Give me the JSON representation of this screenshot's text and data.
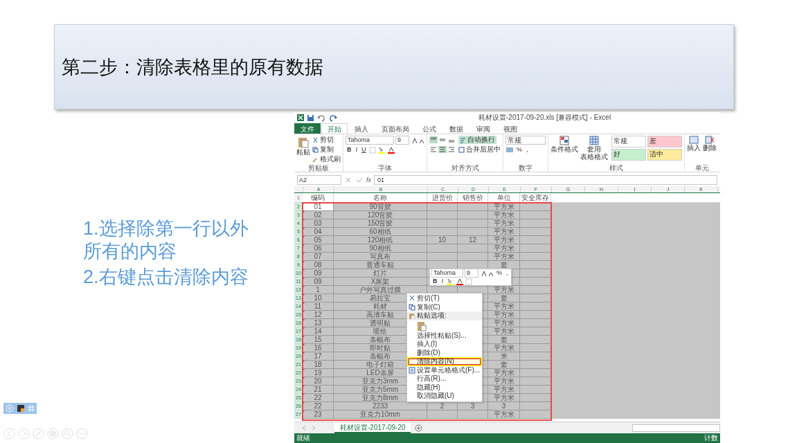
{
  "slide": {
    "title": "第二步：清除表格里的原有数据",
    "steps": [
      "1.选择除第一行以外所有的内容",
      "2.右键点击清除内容"
    ]
  },
  "excel": {
    "title": "耗材设置-2017-09-20.xls  [兼容模式] - Excel",
    "tabs": [
      {
        "label": "文件",
        "kind": "file",
        "selected": false
      },
      {
        "label": "开始",
        "kind": "tab",
        "selected": true
      },
      {
        "label": "插入",
        "kind": "tab",
        "selected": false
      },
      {
        "label": "页面布局",
        "kind": "tab",
        "selected": false
      },
      {
        "label": "公式",
        "kind": "tab",
        "selected": false
      },
      {
        "label": "数据",
        "kind": "tab",
        "selected": false
      },
      {
        "label": "审阅",
        "kind": "tab",
        "selected": false
      },
      {
        "label": "视图",
        "kind": "tab",
        "selected": false
      }
    ],
    "ribbon": {
      "clipboard": {
        "paste": "粘贴",
        "cut": "剪切",
        "copy": "复制",
        "painter": "格式刷",
        "label": "剪贴板"
      },
      "font": {
        "name": "Tahoma",
        "size": "9",
        "bold": "B",
        "italic": "I",
        "underline": "U",
        "label": "字体"
      },
      "alignment": {
        "wrap": "自动换行",
        "merge": "合并后居中",
        "label": "对齐方式"
      },
      "number": {
        "format": "常规",
        "percent": "%",
        "comma": ",",
        "label": "数字"
      },
      "styles": {
        "conditional": "条件格式",
        "table": "套用",
        "table_2": "表格格式",
        "label": "样式",
        "gallery": [
          {
            "label": "常规",
            "color": "#ffffff"
          },
          {
            "label": "差",
            "color": "#ffc7ce"
          },
          {
            "label": "好",
            "color": "#c6efce"
          },
          {
            "label": "适中",
            "color": "#ffeb9c"
          }
        ]
      },
      "cells": {
        "insert": "插入",
        "delete": "删除",
        "label": "单元"
      }
    },
    "name_box": "A2",
    "function_label": "fx",
    "formula": "01",
    "columns": [
      "A",
      "B",
      "C",
      "D",
      "E",
      "F",
      "G",
      "H",
      "I",
      "J",
      "K"
    ],
    "header": {
      "number": "1",
      "cells": [
        "编码",
        "名称",
        "进货价",
        "销售价",
        "单位",
        "安全库存"
      ]
    },
    "rows": [
      {
        "number": "2",
        "selected": true,
        "active": true,
        "cells": [
          "01",
          "90背胶",
          "",
          "",
          "平方米",
          ""
        ]
      },
      {
        "number": "3",
        "selected": true,
        "active": false,
        "cells": [
          "02",
          "120背胶",
          "",
          "",
          "平方米",
          ""
        ]
      },
      {
        "number": "4",
        "selected": true,
        "active": false,
        "cells": [
          "03",
          "150背胶",
          "",
          "",
          "平方米",
          ""
        ]
      },
      {
        "number": "5",
        "selected": true,
        "active": false,
        "cells": [
          "04",
          "60相纸",
          "",
          "",
          "平方米",
          ""
        ]
      },
      {
        "number": "6",
        "selected": true,
        "active": false,
        "cells": [
          "05",
          "120相纸",
          "10",
          "12",
          "平方米",
          ""
        ]
      },
      {
        "number": "7",
        "selected": true,
        "active": false,
        "cells": [
          "06",
          "90相纸",
          "",
          "",
          "平方米",
          ""
        ]
      },
      {
        "number": "8",
        "selected": true,
        "active": false,
        "cells": [
          "07",
          "写真布",
          "",
          "",
          "平方米",
          ""
        ]
      },
      {
        "number": "9",
        "selected": true,
        "active": false,
        "cells": [
          "08",
          "普通车贴",
          "",
          "",
          "套",
          ""
        ]
      },
      {
        "number": "10",
        "selected": true,
        "active": false,
        "cells": [
          "09",
          "灯片",
          "",
          "",
          "",
          ""
        ]
      },
      {
        "number": "11",
        "selected": true,
        "active": false,
        "cells": [
          "09",
          "X展架",
          "",
          "",
          "",
          ""
        ]
      },
      {
        "number": "12",
        "selected": true,
        "active": false,
        "cells": [
          "1",
          "户外写真过膜",
          "",
          "",
          "平方米",
          ""
        ]
      },
      {
        "number": "13",
        "selected": true,
        "active": false,
        "cells": [
          "10",
          "易拉宝",
          "",
          "",
          "套",
          ""
        ]
      },
      {
        "number": "14",
        "selected": true,
        "active": false,
        "cells": [
          "11",
          "耗材",
          "",
          "",
          "平方米",
          ""
        ]
      },
      {
        "number": "15",
        "selected": true,
        "active": false,
        "cells": [
          "12",
          "高清车贴",
          "",
          "",
          "平方米",
          ""
        ]
      },
      {
        "number": "16",
        "selected": true,
        "active": false,
        "cells": [
          "13",
          "透明贴",
          "",
          "",
          "平方米",
          ""
        ]
      },
      {
        "number": "17",
        "selected": true,
        "active": false,
        "cells": [
          "14",
          "喷绘",
          "",
          "",
          "平方米",
          ""
        ]
      },
      {
        "number": "18",
        "selected": true,
        "active": false,
        "cells": [
          "15",
          "条幅布",
          "",
          "",
          "套",
          ""
        ]
      },
      {
        "number": "19",
        "selected": true,
        "active": false,
        "cells": [
          "16",
          "即时贴",
          "",
          "",
          "平方米",
          ""
        ]
      },
      {
        "number": "20",
        "selected": true,
        "active": false,
        "cells": [
          "17",
          "条幅布",
          "",
          "",
          "米",
          ""
        ]
      },
      {
        "number": "21",
        "selected": true,
        "active": false,
        "cells": [
          "18",
          "电子灯箱",
          "",
          "",
          "套",
          ""
        ]
      },
      {
        "number": "22",
        "selected": true,
        "active": false,
        "cells": [
          "19",
          "LED条屏",
          "",
          "",
          "平方米",
          ""
        ]
      },
      {
        "number": "23",
        "selected": true,
        "active": false,
        "cells": [
          "20",
          "亚克力3mm",
          "",
          "",
          "平方米",
          ""
        ]
      },
      {
        "number": "24",
        "selected": true,
        "active": false,
        "cells": [
          "21",
          "亚克力5mm",
          "",
          "",
          "平方米",
          ""
        ]
      },
      {
        "number": "25",
        "selected": true,
        "active": false,
        "cells": [
          "22",
          "亚克力8mm",
          "",
          "",
          "平方米",
          ""
        ]
      },
      {
        "number": "26",
        "selected": true,
        "active": false,
        "cells": [
          "22",
          "2233",
          "2",
          "3",
          "3",
          ""
        ]
      },
      {
        "number": "27",
        "selected": true,
        "active": false,
        "cells": [
          "23",
          "亚克力10mm",
          "",
          "",
          "平方米",
          ""
        ]
      }
    ],
    "mini_toolbar": {
      "font": "Tahoma",
      "size": "9",
      "percent": "%",
      "comma": ",",
      "bold": "B",
      "italic": "I"
    },
    "context_menu": [
      {
        "kind": "item",
        "label": "剪切(T)",
        "highlighted": false
      },
      {
        "kind": "item",
        "label": "复制(C)",
        "highlighted": false
      },
      {
        "kind": "header",
        "label": "粘贴选项:"
      },
      {
        "kind": "paste"
      },
      {
        "kind": "item",
        "label": "选择性粘贴(S)...",
        "highlighted": false
      },
      {
        "kind": "item",
        "label": "插入(I)",
        "highlighted": false
      },
      {
        "kind": "item",
        "label": "删除(D)",
        "highlighted": false
      },
      {
        "kind": "item",
        "label": "清除内容(N)",
        "highlighted": true
      },
      {
        "kind": "item",
        "label": "设置单元格格式(F)...",
        "highlighted": false
      },
      {
        "kind": "item",
        "label": "行高(R)...",
        "highlighted": false
      },
      {
        "kind": "item",
        "label": "隐藏(H)",
        "highlighted": false
      },
      {
        "kind": "item",
        "label": "取消隐藏(U)",
        "highlighted": false
      }
    ],
    "sheet_tab": "耗材设置-2017-09-20",
    "status": {
      "left": "就绪",
      "right": "计数"
    }
  }
}
